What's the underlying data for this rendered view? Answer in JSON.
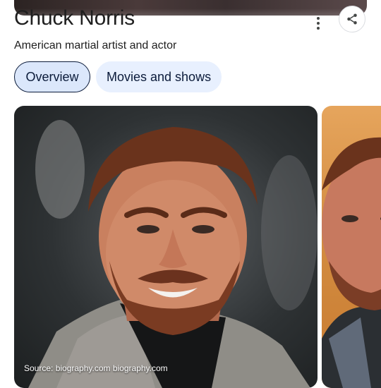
{
  "entity": {
    "title": "Chuck Norris",
    "subtitle": "American martial artist and actor"
  },
  "tabs": [
    {
      "label": "Overview",
      "selected": true
    },
    {
      "label": "Movies and shows",
      "selected": false
    }
  ],
  "actions": {
    "more_icon": "more-vert-icon",
    "share_icon": "share-icon"
  },
  "images": {
    "main_source": "Source: biography.com biography.com"
  },
  "colors": {
    "chip_selected_bg": "#dbe7fb",
    "chip_bg": "#e8f0fe",
    "chip_text": "#0b1b3a"
  }
}
